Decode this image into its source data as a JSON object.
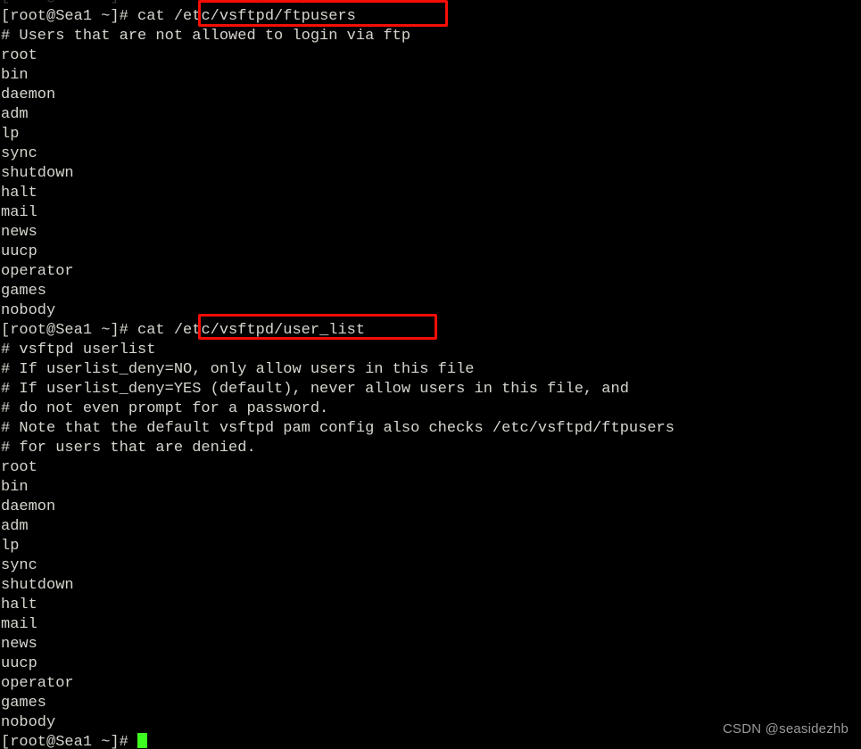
{
  "terminal": {
    "prompt": "[root@Sea1 ~]#",
    "cursor_color": "#3dfc20",
    "text_color": "#d6d6cf",
    "background_color": "#000000",
    "highlight_color": "#f50d06",
    "ghost_line": "[root@Sea1 ~]# cat /etc/vsftpd/ftpusers"
  },
  "commands": {
    "first": {
      "prompt": "[root@Sea1 ~]# ",
      "command": "cat ",
      "argument": "/etc/vsftpd/ftpusers"
    },
    "second": {
      "prompt": "[root@Sea1 ~]# ",
      "command": "cat ",
      "argument": "/etc/vsftpd/user_list"
    },
    "final": {
      "prompt": "[root@Sea1 ~]# ",
      "command": ""
    }
  },
  "ftpusers_output": {
    "comments": [
      "# Users that are not allowed to login via ftp"
    ],
    "users": [
      "root",
      "bin",
      "daemon",
      "adm",
      "lp",
      "sync",
      "shutdown",
      "halt",
      "mail",
      "news",
      "uucp",
      "operator",
      "games",
      "nobody"
    ]
  },
  "user_list_output": {
    "comments": [
      "# vsftpd userlist",
      "# If userlist_deny=NO, only allow users in this file",
      "# If userlist_deny=YES (default), never allow users in this file, and",
      "# do not even prompt for a password.",
      "# Note that the default vsftpd pam config also checks /etc/vsftpd/ftpusers",
      "# for users that are denied."
    ],
    "users": [
      "root",
      "bin",
      "daemon",
      "adm",
      "lp",
      "sync",
      "shutdown",
      "halt",
      "mail",
      "news",
      "uucp",
      "operator",
      "games",
      "nobody"
    ]
  },
  "watermark": {
    "text": "CSDN @seasidezhb"
  }
}
